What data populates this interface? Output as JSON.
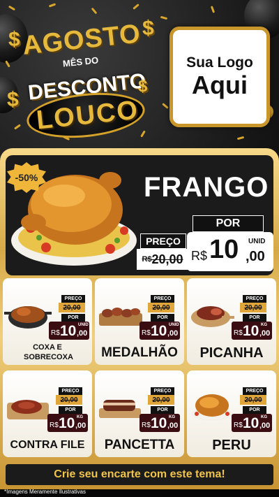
{
  "header": {
    "title_agosto": "AGOSTO",
    "title_mes": "MÊS DO",
    "title_desconto": "DESCONTO",
    "title_louco": "LOUCO",
    "logo_line1": "Sua Logo",
    "logo_line2": "Aqui"
  },
  "featured": {
    "badge": "-50%",
    "name": "FRANGO",
    "preco_label": "PREÇO",
    "old_currency": "R$",
    "old_value": "20,00",
    "por_label": "POR",
    "currency": "R$",
    "price_int": "10",
    "price_dec": ",00",
    "unit": "UNID"
  },
  "products": [
    {
      "name": "COXA E SOBRECOXA",
      "preco_label": "PREÇO",
      "old_value": "20,00",
      "por_label": "POR",
      "currency": "R$",
      "price_int": "10",
      "price_dec": ",00",
      "unit": "UNID"
    },
    {
      "name": "MEDALHÃO",
      "preco_label": "PREÇO",
      "old_value": "20,00",
      "por_label": "POR",
      "currency": "R$",
      "price_int": "10",
      "price_dec": ",00",
      "unit": "UNID"
    },
    {
      "name": "PICANHA",
      "preco_label": "PREÇO",
      "old_value": "20,00",
      "por_label": "POR",
      "currency": "R$",
      "price_int": "10",
      "price_dec": ",00",
      "unit": "KG"
    },
    {
      "name": "CONTRA FILE",
      "preco_label": "PREÇO",
      "old_value": "20,00",
      "por_label": "POR",
      "currency": "R$",
      "price_int": "10",
      "price_dec": ",00",
      "unit": "KG"
    },
    {
      "name": "PANCETTA",
      "preco_label": "PREÇO",
      "old_value": "20,00",
      "por_label": "POR",
      "currency": "R$",
      "price_int": "10",
      "price_dec": ",00",
      "unit": "KG"
    },
    {
      "name": "PERU",
      "preco_label": "PREÇO",
      "old_value": "20,00",
      "por_label": "POR",
      "currency": "R$",
      "price_int": "10",
      "price_dec": ",00",
      "unit": "KG"
    }
  ],
  "footer": {
    "cta": "Crie seu encarte com este tema!",
    "disclaimer": "*Imagens Meramente Ilustrativas"
  },
  "colors": {
    "gold": "#d6a947",
    "dark": "#1b1b1b",
    "price_bg": "#3a0d12",
    "accent_text": "#f1c44a"
  }
}
